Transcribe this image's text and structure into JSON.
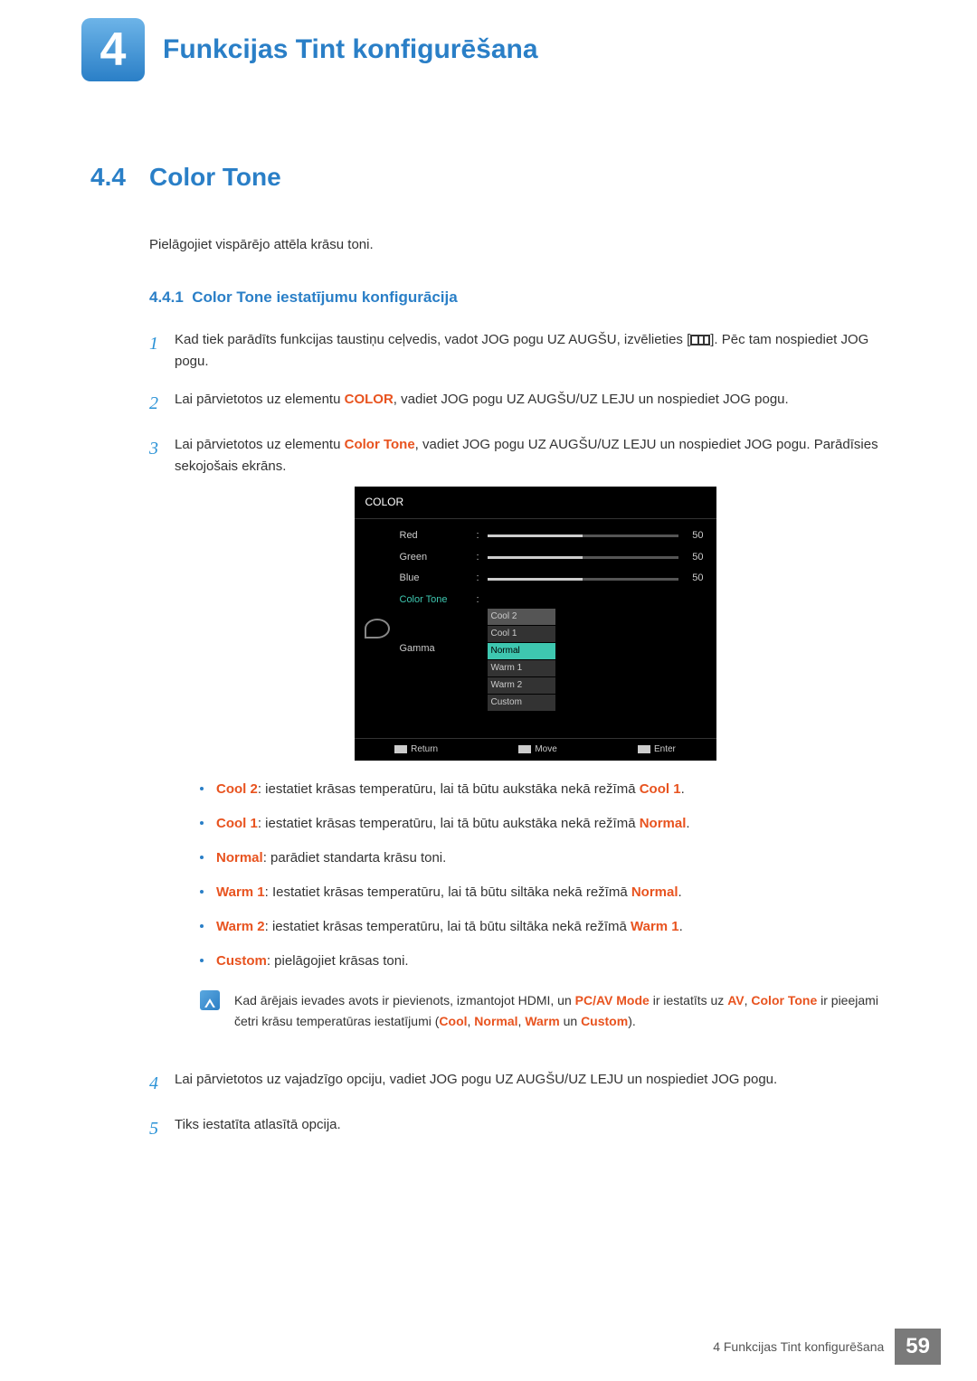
{
  "chapter": {
    "number": "4",
    "title": "Funkcijas Tint  konfigurēšana"
  },
  "section": {
    "number": "4.4",
    "title": "Color Tone",
    "intro": "Pielāgojiet vispārējo attēla krāsu toni."
  },
  "subsection": {
    "number": "4.4.1",
    "title": "Color Tone iestatījumu konfigurācija"
  },
  "steps": {
    "s1a": "Kad tiek parādīts funkcijas taustiņu ceļvedis, vadot JOG pogu UZ AUGŠU, izvēlieties [",
    "s1b": "]. Pēc tam nospiediet JOG pogu.",
    "s2a": "Lai pārvietotos uz elementu ",
    "s2_kw": "COLOR",
    "s2b": ", vadiet JOG pogu UZ AUGŠU/UZ LEJU un nospiediet JOG pogu.",
    "s3a": "Lai pārvietotos uz elementu ",
    "s3_kw": "Color Tone",
    "s3b": ", vadiet JOG pogu UZ AUGŠU/UZ LEJU un nospiediet JOG pogu. Parādīsies sekojošais ekrāns.",
    "s4": "Lai pārvietotos uz vajadzīgo opciju, vadiet JOG pogu UZ AUGŠU/UZ LEJU un nospiediet JOG pogu.",
    "s5": "Tiks iestatīta atlasītā opcija."
  },
  "osd": {
    "title": "COLOR",
    "rows": {
      "red": {
        "label": "Red",
        "value": "50"
      },
      "green": {
        "label": "Green",
        "value": "50"
      },
      "blue": {
        "label": "Blue",
        "value": "50"
      },
      "tone": {
        "label": "Color Tone"
      },
      "gamma": {
        "label": "Gamma"
      }
    },
    "options": {
      "o1": "Cool 2",
      "o2": "Cool 1",
      "o3": "Normal",
      "o4": "Warm 1",
      "o5": "Warm 2",
      "o6": "Custom"
    },
    "footer": {
      "return": "Return",
      "move": "Move",
      "enter": "Enter"
    }
  },
  "bullets": {
    "cool2": {
      "name": "Cool 2",
      "text": ": iestatiet krāsas temperatūru, lai tā būtu aukstāka nekā režīmā ",
      "ref": "Cool 1",
      "tail": "."
    },
    "cool1": {
      "name": "Cool 1",
      "text": ": iestatiet krāsas temperatūru, lai tā būtu aukstāka nekā režīmā ",
      "ref": "Normal",
      "tail": "."
    },
    "normal": {
      "name": "Normal",
      "text": ": parādiet standarta krāsu toni.",
      "ref": "",
      "tail": ""
    },
    "warm1": {
      "name": "Warm 1",
      "text": ": Iestatiet krāsas temperatūru, lai tā būtu siltāka nekā režīmā ",
      "ref": "Normal",
      "tail": "."
    },
    "warm2": {
      "name": "Warm 2",
      "text": ": iestatiet krāsas temperatūru, lai tā būtu siltāka nekā režīmā ",
      "ref": "Warm 1",
      "tail": "."
    },
    "custom": {
      "name": "Custom",
      "text": ": pielāgojiet krāsas toni.",
      "ref": "",
      "tail": ""
    }
  },
  "note": {
    "l1a": "Kad ārējais ievades avots ir pievienots, izmantojot HDMI, un ",
    "l1_kw1": "PC/AV Mode",
    "l1b": " ir iestatīts uz ",
    "l1_kw2": "AV",
    "l1c": ", ",
    "l2_kw": "Color Tone",
    "l2a": " ir pieejami četri krāsu temperatūras iestatījumi (",
    "l2_cool": "Cool",
    "sep1": ", ",
    "l2_normal": "Normal",
    "sep2": ", ",
    "l2_warm": "Warm",
    "sep3": " un ",
    "l2_custom": "Custom",
    "l2b": ")."
  },
  "footer": {
    "text": "4 Funkcijas Tint  konfigurēšana",
    "page": "59"
  }
}
